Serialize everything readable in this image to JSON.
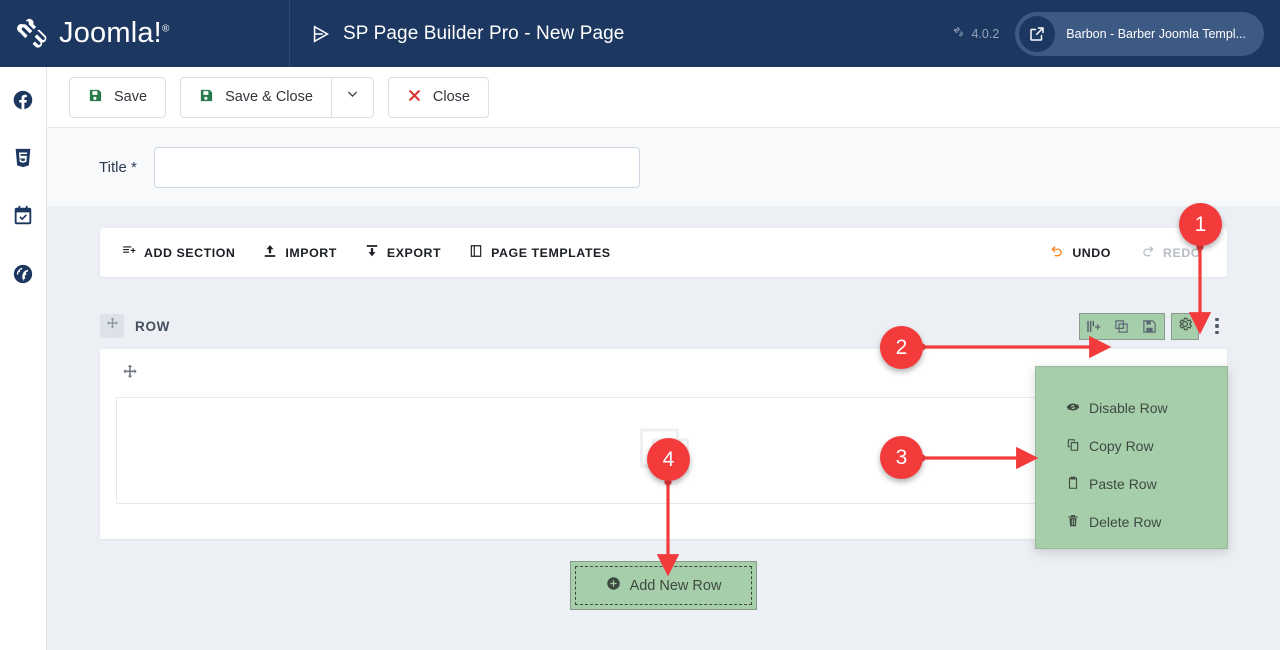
{
  "topbar": {
    "brand_name": "Joomla!",
    "brand_icon": "joomla-logo-icon",
    "app_icon": "sp-pagebuilder-play-icon",
    "app_title": "SP Page Builder Pro - New Page",
    "joomla_version": "4.0.2",
    "version_icon": "joomla-mark-icon",
    "preview_icon": "external-link-icon",
    "preview_label": "Barbon - Barber Joomla Templ..."
  },
  "rail": {
    "items": [
      {
        "icon": "facebook-icon",
        "name": "sidebar-item-facebook"
      },
      {
        "icon": "css3-shield-icon",
        "name": "sidebar-item-css3"
      },
      {
        "icon": "calendar-check-icon",
        "name": "sidebar-item-calendar"
      },
      {
        "icon": "globe-icon",
        "name": "sidebar-item-globe"
      }
    ]
  },
  "toolbar": {
    "save_label": "Save",
    "save_icon": "floppy-disk-icon",
    "save_close_label": "Save & Close",
    "save_close_icon": "floppy-disk-icon",
    "dropdown_icon": "chevron-down-icon",
    "close_label": "Close",
    "close_icon": "x-mark-icon",
    "save_icon_color": "#297a4c",
    "close_icon_color": "#d9342b"
  },
  "form": {
    "title_label": "Title *",
    "title_value": "",
    "title_placeholder": ""
  },
  "section_toolbar": {
    "left": [
      {
        "label": "ADD SECTION",
        "icon": "add-section-icon"
      },
      {
        "label": "IMPORT",
        "icon": "upload-icon"
      },
      {
        "label": "EXPORT",
        "icon": "download-icon"
      },
      {
        "label": "PAGE TEMPLATES",
        "icon": "page-templates-icon"
      }
    ],
    "undo_label": "UNDO",
    "undo_icon": "undo-arrow-icon",
    "undo_color": "#f58220",
    "redo_label": "REDO",
    "redo_icon": "redo-arrow-icon",
    "redo_disabled": true
  },
  "row": {
    "drag_icon": "move-arrows-icon",
    "label": "ROW",
    "controls": [
      {
        "icon": "add-column-icon",
        "name": "row-add-column-button",
        "highlighted": true
      },
      {
        "icon": "duplicate-row-icon",
        "name": "row-duplicate-button",
        "highlighted": true
      },
      {
        "icon": "save-row-icon",
        "name": "row-save-button",
        "highlighted": true
      },
      {
        "icon": "gear-icon",
        "name": "row-settings-button",
        "highlighted": true
      }
    ],
    "more_icon": "vertical-ellipsis-icon",
    "column_drag_icon": "move-arrows-icon",
    "placeholder_icon": "empty-column-placeholder-icon"
  },
  "row_menu": {
    "items": [
      {
        "label": "Disable Row",
        "icon": "eye-slash-icon"
      },
      {
        "label": "Copy Row",
        "icon": "copy-icon"
      },
      {
        "label": "Paste Row",
        "icon": "paste-icon"
      },
      {
        "label": "Delete Row",
        "icon": "trash-icon"
      }
    ]
  },
  "add_new_row": {
    "label": "Add New Row",
    "icon": "plus-circle-icon"
  },
  "annotations": {
    "accent_color": "#f43b3b",
    "highlight_color": "#a7ceab",
    "markers": [
      {
        "id": "1",
        "label": "1"
      },
      {
        "id": "2",
        "label": "2"
      },
      {
        "id": "3",
        "label": "3"
      },
      {
        "id": "4",
        "label": "4"
      }
    ]
  }
}
